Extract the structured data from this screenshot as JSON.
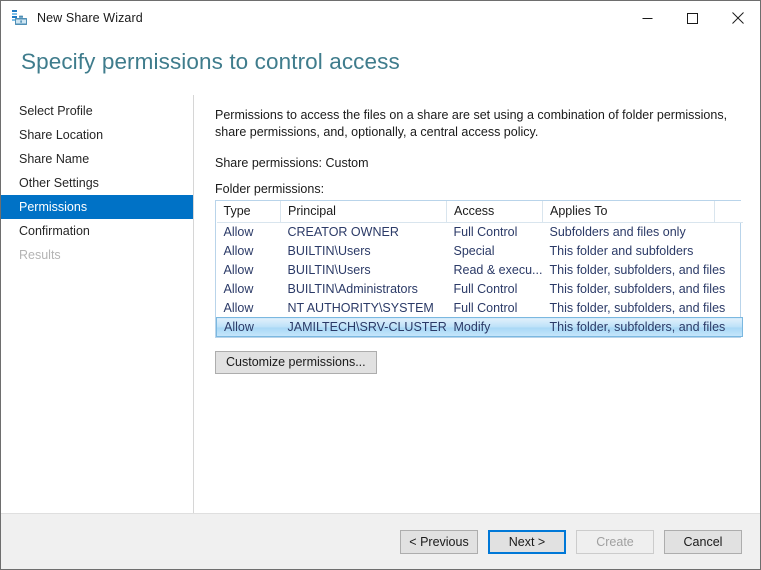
{
  "window": {
    "title": "New Share Wizard",
    "icon": "share-wizard-icon",
    "controls": {
      "minimize": "minimize-icon",
      "maximize": "maximize-icon",
      "close": "close-icon"
    }
  },
  "header": {
    "title": "Specify permissions to control access",
    "title_color": "#3f7c8c"
  },
  "sidebar": {
    "accent_color": "#0072c6",
    "items": [
      {
        "label": "Select Profile",
        "state": "normal"
      },
      {
        "label": "Share Location",
        "state": "normal"
      },
      {
        "label": "Share Name",
        "state": "normal"
      },
      {
        "label": "Other Settings",
        "state": "normal"
      },
      {
        "label": "Permissions",
        "state": "active"
      },
      {
        "label": "Confirmation",
        "state": "normal"
      },
      {
        "label": "Results",
        "state": "disabled"
      }
    ]
  },
  "main": {
    "intro": "Permissions to access the files on a share are set using a combination of folder permissions, share permissions, and, optionally, a central access policy.",
    "share_permissions_label": "Share permissions:",
    "share_permissions_value": "Custom",
    "folder_permissions_label": "Folder permissions:",
    "table": {
      "columns": [
        "Type",
        "Principal",
        "Access",
        "Applies To",
        ""
      ],
      "rows": [
        {
          "type": "Allow",
          "principal": "CREATOR OWNER",
          "access": "Full Control",
          "applies_to": "Subfolders and files only",
          "selected": false
        },
        {
          "type": "Allow",
          "principal": "BUILTIN\\Users",
          "access": "Special",
          "applies_to": "This folder and subfolders",
          "selected": false
        },
        {
          "type": "Allow",
          "principal": "BUILTIN\\Users",
          "access": "Read & execu...",
          "applies_to": "This folder, subfolders, and files",
          "selected": false
        },
        {
          "type": "Allow",
          "principal": "BUILTIN\\Administrators",
          "access": "Full Control",
          "applies_to": "This folder, subfolders, and files",
          "selected": false
        },
        {
          "type": "Allow",
          "principal": "NT AUTHORITY\\SYSTEM",
          "access": "Full Control",
          "applies_to": "This folder, subfolders, and files",
          "selected": false
        },
        {
          "type": "Allow",
          "principal": "JAMILTECH\\SRV-CLUSTER$",
          "access": "Modify",
          "applies_to": "This folder, subfolders, and files",
          "selected": true
        }
      ]
    },
    "customize_button": "Customize permissions..."
  },
  "footer": {
    "previous": "< Previous",
    "next": "Next >",
    "create": "Create",
    "cancel": "Cancel",
    "next_focused": true,
    "create_disabled": true
  }
}
